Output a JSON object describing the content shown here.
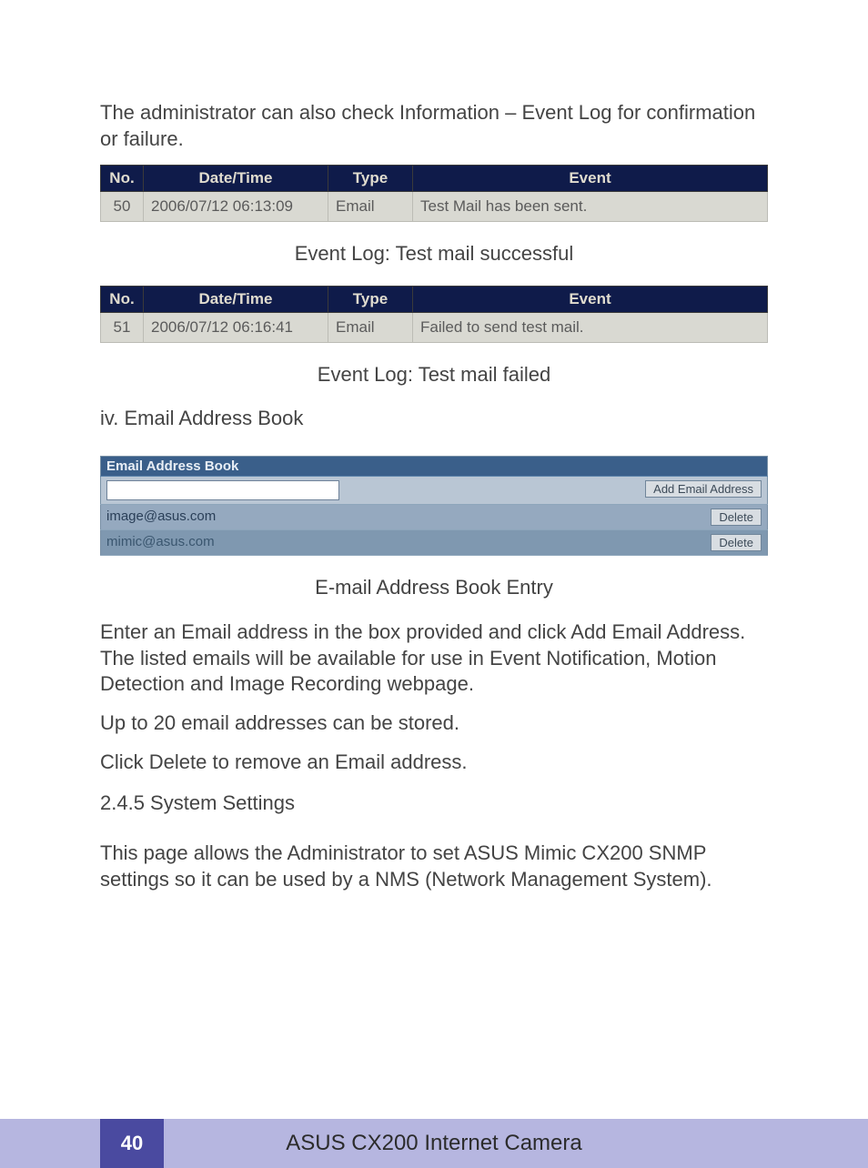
{
  "intro_text": "The administrator can also check Information – Event Log for confirmation or failure.",
  "event_log_headers": {
    "no": "No.",
    "datetime": "Date/Time",
    "type": "Type",
    "event": "Event"
  },
  "event_log_success": {
    "rows": [
      {
        "no": "50",
        "datetime": "2006/07/12 06:13:09",
        "type": "Email",
        "event": "Test Mail has been sent."
      }
    ],
    "caption": "Event Log: Test mail successful"
  },
  "event_log_failed": {
    "rows": [
      {
        "no": "51",
        "datetime": "2006/07/12 06:16:41",
        "type": "Email",
        "event": "Failed to send test mail."
      }
    ],
    "caption": "Event Log: Test mail failed"
  },
  "section_iv_heading": "iv. Email Address Book",
  "address_book": {
    "title": "Email Address Book",
    "input_value": "",
    "add_button": "Add Email Address",
    "delete_button": "Delete",
    "entries": [
      "image@asus.com",
      "mimic@asus.com"
    ],
    "caption": "E-mail Address Book Entry"
  },
  "paragraphs": {
    "p1": "Enter an Email address in the box provided and click Add Email Address. The listed emails will be available for use in Event Notification, Motion Detection and Image Recording webpage.",
    "p2": "Up to 20 email addresses can be stored.",
    "p3": "Click Delete to remove an Email address."
  },
  "subsection_heading": "2.4.5 System Settings",
  "subsection_text": "This page allows the Administrator to set ASUS Mimic CX200 SNMP settings so it can be used by a NMS (Network Management System).",
  "footer": {
    "page_number": "40",
    "doc_title": "ASUS CX200 Internet Camera"
  }
}
